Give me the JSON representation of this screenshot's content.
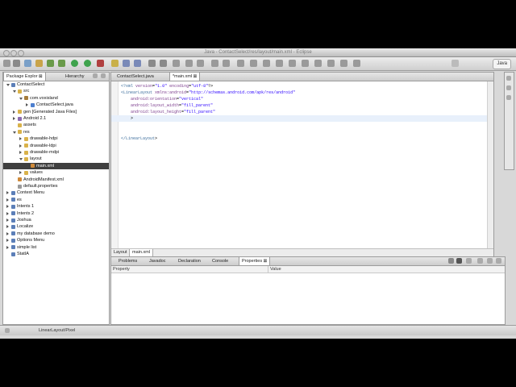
{
  "window": {
    "title": "Java - ContactSelect/res/layout/main.xml - Eclipse"
  },
  "perspective": {
    "label": "Java"
  },
  "left_panel": {
    "tabs": [
      {
        "label": "Package Explor"
      },
      {
        "label": "Hierarchy"
      }
    ],
    "tree": [
      {
        "label": "ContactSelect",
        "level": 0,
        "open": true,
        "icon": "project-icon"
      },
      {
        "label": "src",
        "level": 1,
        "open": true,
        "icon": "folder-icon"
      },
      {
        "label": "com.voxisland",
        "level": 2,
        "open": true,
        "icon": "package-icon"
      },
      {
        "label": "ContactSelect.java",
        "level": 3,
        "open": false,
        "icon": "java-file-icon"
      },
      {
        "label": "gen [Generated Java Files]",
        "level": 1,
        "open": false,
        "icon": "folder-icon"
      },
      {
        "label": "Android 2.1",
        "level": 1,
        "open": false,
        "icon": "library-icon"
      },
      {
        "label": "assets",
        "level": 1,
        "open": null,
        "icon": "folder-icon"
      },
      {
        "label": "res",
        "level": 1,
        "open": true,
        "icon": "folder-icon"
      },
      {
        "label": "drawable-hdpi",
        "level": 2,
        "open": false,
        "icon": "folder-icon"
      },
      {
        "label": "drawable-ldpi",
        "level": 2,
        "open": false,
        "icon": "folder-icon"
      },
      {
        "label": "drawable-mdpi",
        "level": 2,
        "open": false,
        "icon": "folder-icon"
      },
      {
        "label": "layout",
        "level": 2,
        "open": true,
        "icon": "folder-icon"
      },
      {
        "label": "main.xml",
        "level": 3,
        "open": null,
        "icon": "xml-file-icon",
        "selected": true
      },
      {
        "label": "values",
        "level": 2,
        "open": false,
        "icon": "folder-icon"
      },
      {
        "label": "AndroidManifest.xml",
        "level": 1,
        "open": null,
        "icon": "xml-file-icon"
      },
      {
        "label": "default.properties",
        "level": 1,
        "open": null,
        "icon": "file-icon"
      },
      {
        "label": "Context Menu",
        "level": 0,
        "open": false,
        "icon": "project-icon"
      },
      {
        "label": "es",
        "level": 0,
        "open": false,
        "icon": "project-icon"
      },
      {
        "label": "Intents 1",
        "level": 0,
        "open": false,
        "icon": "project-icon"
      },
      {
        "label": "Intents 2",
        "level": 0,
        "open": false,
        "icon": "project-icon"
      },
      {
        "label": "Joshua",
        "level": 0,
        "open": false,
        "icon": "project-icon"
      },
      {
        "label": "Localize",
        "level": 0,
        "open": false,
        "icon": "project-icon"
      },
      {
        "label": "my database demo",
        "level": 0,
        "open": false,
        "icon": "project-icon"
      },
      {
        "label": "Options Menu",
        "level": 0,
        "open": false,
        "icon": "project-icon"
      },
      {
        "label": "simple list",
        "level": 0,
        "open": false,
        "icon": "project-icon"
      },
      {
        "label": "StatIA",
        "level": 0,
        "open": null,
        "icon": "project-icon"
      }
    ]
  },
  "editor": {
    "tabs": [
      {
        "label": "ContactSelect.java"
      },
      {
        "label": "*main.xml"
      }
    ],
    "lines": [
      [
        "<?xml version=\"1.0\" encoding=\"utf-8\"?>"
      ],
      [
        "<LinearLayout xmlns:android=\"http://schemas.android.com/apk/res/android\""
      ],
      [
        "    android:orientation=\"vertical\""
      ],
      [
        "    android:layout_width=\"fill_parent\""
      ],
      [
        "    android:layout_height=\"fill_parent\""
      ],
      [
        "    >"
      ],
      [
        ""
      ],
      [
        ""
      ],
      [
        "</LinearLayout>"
      ]
    ],
    "footer_tabs": [
      {
        "label": "Layout"
      },
      {
        "label": "main.xml"
      }
    ]
  },
  "bottom_panel": {
    "tabs": [
      {
        "label": "Problems"
      },
      {
        "label": "Javadoc"
      },
      {
        "label": "Declaration"
      },
      {
        "label": "Console"
      },
      {
        "label": "Properties"
      }
    ],
    "columns": [
      {
        "label": "Property"
      },
      {
        "label": "Value"
      }
    ]
  },
  "status": {
    "text": "LinearLayout/Pixel"
  }
}
